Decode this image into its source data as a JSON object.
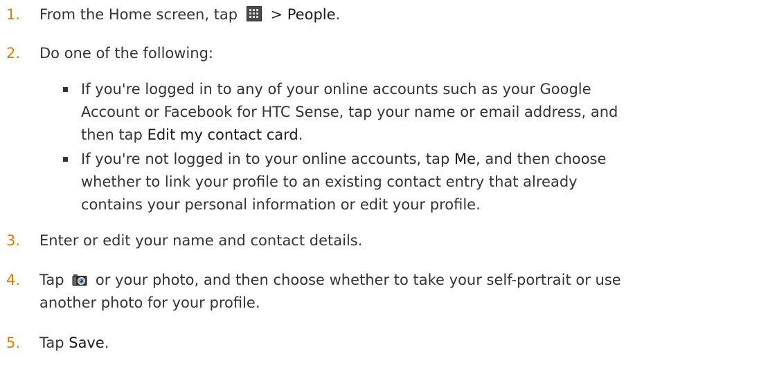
{
  "steps": [
    {
      "number": "1.",
      "before": "From the Home screen, tap",
      "icon": "apps-grid-icon",
      "middle": " > ",
      "ui": "People",
      "after": "."
    },
    {
      "number": "2.",
      "text": "Do one of the following:"
    },
    {
      "number": "3.",
      "text": "Enter or edit your name and contact details."
    },
    {
      "number": "4.",
      "before": "Tap",
      "icon": "camera-icon",
      "line1_after": "or your photo, and then choose whether to take your self-portrait or use",
      "line2": "another photo for your profile."
    },
    {
      "number": "5.",
      "before": "Tap ",
      "ui": "Save",
      "after": "."
    }
  ],
  "bullets": [
    {
      "line1": "If you're logged in to any of your online accounts such as your Google",
      "line2": "Account or Facebook for HTC Sense, tap your name or email address, and",
      "line3_before": "then tap ",
      "line3_ui": "Edit my contact card",
      "line3_after": "."
    },
    {
      "line1_before": "If you're not logged in to your online accounts, tap ",
      "line1_ui": "Me",
      "line1_after": ", and then choose",
      "line2": "whether to link your profile to an existing contact entry that already",
      "line3": "contains your personal information or edit your profile."
    }
  ],
  "colors": {
    "step_number": "#e07b00",
    "body_text": "#333333"
  }
}
